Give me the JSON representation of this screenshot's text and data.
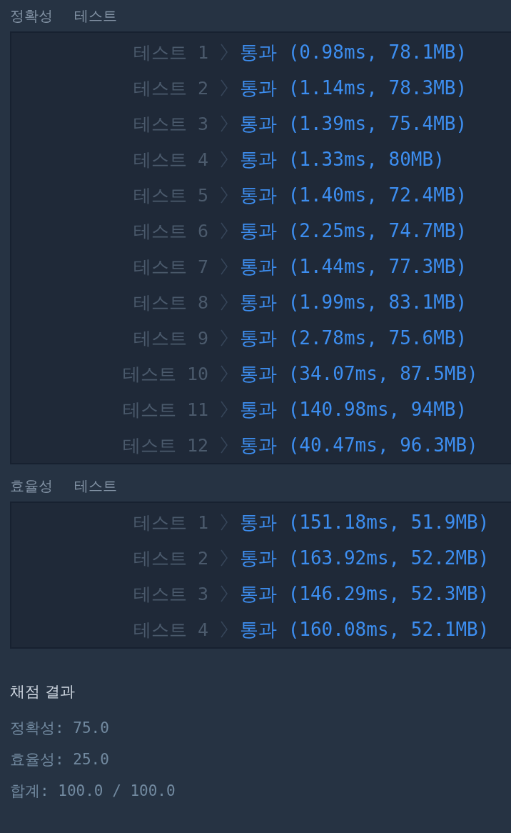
{
  "sections": [
    {
      "heading": [
        "정확성",
        "테스트"
      ],
      "tests": [
        {
          "label": "테스트 1",
          "result": "통과 (0.98ms, 78.1MB)"
        },
        {
          "label": "테스트 2",
          "result": "통과 (1.14ms, 78.3MB)"
        },
        {
          "label": "테스트 3",
          "result": "통과 (1.39ms, 75.4MB)"
        },
        {
          "label": "테스트 4",
          "result": "통과 (1.33ms, 80MB)"
        },
        {
          "label": "테스트 5",
          "result": "통과 (1.40ms, 72.4MB)"
        },
        {
          "label": "테스트 6",
          "result": "통과 (2.25ms, 74.7MB)"
        },
        {
          "label": "테스트 7",
          "result": "통과 (1.44ms, 77.3MB)"
        },
        {
          "label": "테스트 8",
          "result": "통과 (1.99ms, 83.1MB)"
        },
        {
          "label": "테스트 9",
          "result": "통과 (2.78ms, 75.6MB)"
        },
        {
          "label": "테스트 10",
          "result": "통과 (34.07ms, 87.5MB)"
        },
        {
          "label": "테스트 11",
          "result": "통과 (140.98ms, 94MB)"
        },
        {
          "label": "테스트 12",
          "result": "통과 (40.47ms, 96.3MB)"
        }
      ]
    },
    {
      "heading": [
        "효율성",
        "테스트"
      ],
      "tests": [
        {
          "label": "테스트 1",
          "result": "통과 (151.18ms, 51.9MB)"
        },
        {
          "label": "테스트 2",
          "result": "통과 (163.92ms, 52.2MB)"
        },
        {
          "label": "테스트 3",
          "result": "통과 (146.29ms, 52.3MB)"
        },
        {
          "label": "테스트 4",
          "result": "통과 (160.08ms, 52.1MB)"
        }
      ]
    }
  ],
  "summary": {
    "title": "채점 결과",
    "lines": [
      "정확성: 75.0",
      "효율성: 25.0",
      "합계: 100.0 / 100.0"
    ]
  }
}
